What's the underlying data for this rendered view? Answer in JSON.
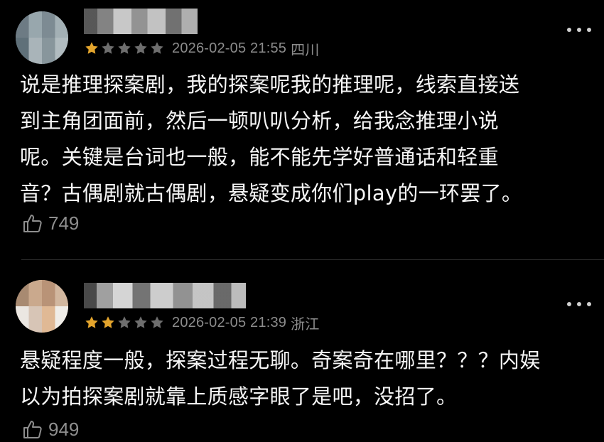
{
  "reviews": [
    {
      "avatar_icon": "user-avatar-icon",
      "rating": 1,
      "max_rating": 5,
      "date_time": "2026-02-05 21:55",
      "location": "四川",
      "content": "说是推理探案剧，我的探案呢我的推理呢，线索直接送\n到主角团面前，然后一顿叭叭分析，给我念推理小说\n呢。关键是台词也一般，能不能先学好普通话和轻重\n音？古偶剧就古偶剧，悬疑变成你们play的一环罢了。",
      "likes": "749"
    },
    {
      "avatar_icon": "user-avatar-icon",
      "rating": 2,
      "max_rating": 5,
      "date_time": "2026-02-05 21:39",
      "location": "浙江",
      "content": "悬疑程度一般，探案过程无聊。奇案奇在哪里？？？内娱\n以为拍探案剧就靠上质感字眼了是吧，没招了。",
      "likes": "949"
    }
  ],
  "colors": {
    "background": "#000000",
    "star_filled": "#e4a52d",
    "star_empty": "#6e6e6e",
    "meta_text": "#8c8c8c",
    "content_text": "#f5f5f5"
  }
}
